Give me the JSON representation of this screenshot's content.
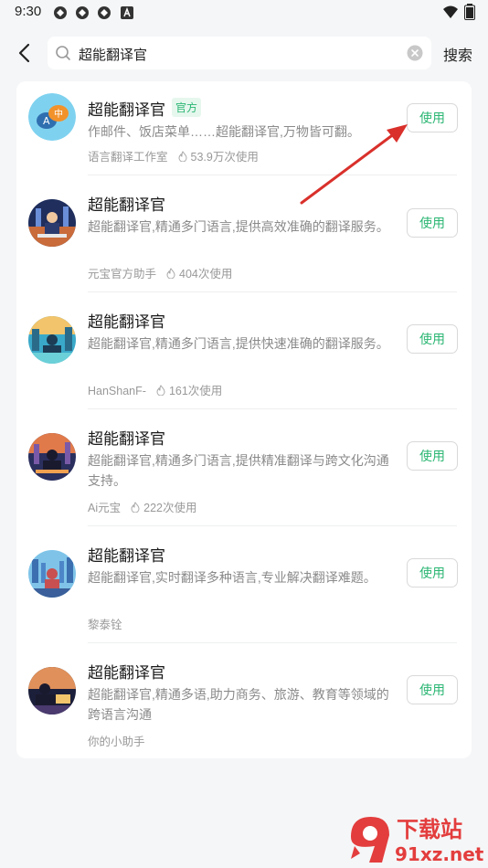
{
  "status_bar": {
    "time": "9:30"
  },
  "header": {
    "search_value": "超能翻译官",
    "search_button": "搜索"
  },
  "results": [
    {
      "title": "超能翻译官",
      "tag": "官方",
      "desc": "作邮件、饭店菜单……超能翻译官,万物皆可翻。",
      "author": "语言翻译工作室",
      "uses": "53.9万次使用",
      "button": "使用"
    },
    {
      "title": "超能翻译官",
      "desc": "超能翻译官,精通多门语言,提供高效准确的翻译服务。",
      "author": "元宝官方助手",
      "uses": "404次使用",
      "button": "使用"
    },
    {
      "title": "超能翻译官",
      "desc": "超能翻译官,精通多门语言,提供快速准确的翻译服务。",
      "author": "HanShanF-",
      "uses": "161次使用",
      "button": "使用"
    },
    {
      "title": "超能翻译官",
      "desc": "超能翻译官,精通多门语言,提供精准翻译与跨文化沟通支持。",
      "author": "Ai元宝",
      "uses": "222次使用",
      "button": "使用"
    },
    {
      "title": "超能翻译官",
      "desc": "超能翻译官,实时翻译多种语言,专业解决翻译难题。",
      "author": "黎泰铨",
      "button": "使用"
    },
    {
      "title": "超能翻译官",
      "desc": "超能翻译官,精通多语,助力商务、旅游、教育等领域的跨语言沟通",
      "author": "你的小助手",
      "button": "使用"
    }
  ],
  "watermark": {
    "line1": "下载站",
    "line2": "91xz.net"
  },
  "colors": {
    "accent": "#2bb673",
    "annotation_arrow": "#d9302b"
  }
}
